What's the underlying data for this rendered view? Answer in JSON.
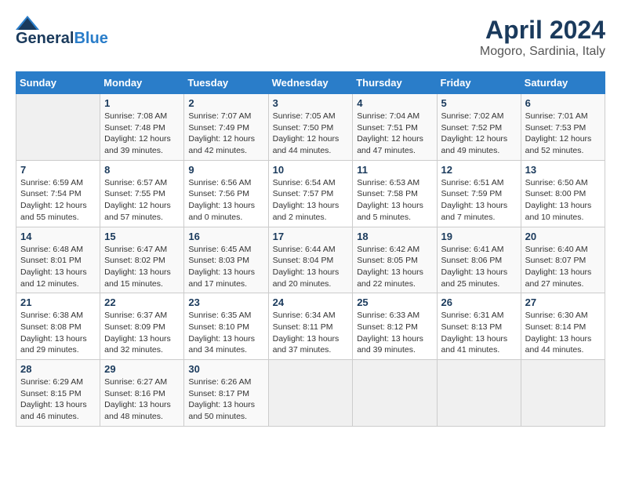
{
  "header": {
    "logo_line1": "General",
    "logo_line2": "Blue",
    "title": "April 2024",
    "subtitle": "Mogoro, Sardinia, Italy"
  },
  "columns": [
    "Sunday",
    "Monday",
    "Tuesday",
    "Wednesday",
    "Thursday",
    "Friday",
    "Saturday"
  ],
  "weeks": [
    [
      {
        "day": "",
        "info": ""
      },
      {
        "day": "1",
        "info": "Sunrise: 7:08 AM\nSunset: 7:48 PM\nDaylight: 12 hours\nand 39 minutes."
      },
      {
        "day": "2",
        "info": "Sunrise: 7:07 AM\nSunset: 7:49 PM\nDaylight: 12 hours\nand 42 minutes."
      },
      {
        "day": "3",
        "info": "Sunrise: 7:05 AM\nSunset: 7:50 PM\nDaylight: 12 hours\nand 44 minutes."
      },
      {
        "day": "4",
        "info": "Sunrise: 7:04 AM\nSunset: 7:51 PM\nDaylight: 12 hours\nand 47 minutes."
      },
      {
        "day": "5",
        "info": "Sunrise: 7:02 AM\nSunset: 7:52 PM\nDaylight: 12 hours\nand 49 minutes."
      },
      {
        "day": "6",
        "info": "Sunrise: 7:01 AM\nSunset: 7:53 PM\nDaylight: 12 hours\nand 52 minutes."
      }
    ],
    [
      {
        "day": "7",
        "info": "Sunrise: 6:59 AM\nSunset: 7:54 PM\nDaylight: 12 hours\nand 55 minutes."
      },
      {
        "day": "8",
        "info": "Sunrise: 6:57 AM\nSunset: 7:55 PM\nDaylight: 12 hours\nand 57 minutes."
      },
      {
        "day": "9",
        "info": "Sunrise: 6:56 AM\nSunset: 7:56 PM\nDaylight: 13 hours\nand 0 minutes."
      },
      {
        "day": "10",
        "info": "Sunrise: 6:54 AM\nSunset: 7:57 PM\nDaylight: 13 hours\nand 2 minutes."
      },
      {
        "day": "11",
        "info": "Sunrise: 6:53 AM\nSunset: 7:58 PM\nDaylight: 13 hours\nand 5 minutes."
      },
      {
        "day": "12",
        "info": "Sunrise: 6:51 AM\nSunset: 7:59 PM\nDaylight: 13 hours\nand 7 minutes."
      },
      {
        "day": "13",
        "info": "Sunrise: 6:50 AM\nSunset: 8:00 PM\nDaylight: 13 hours\nand 10 minutes."
      }
    ],
    [
      {
        "day": "14",
        "info": "Sunrise: 6:48 AM\nSunset: 8:01 PM\nDaylight: 13 hours\nand 12 minutes."
      },
      {
        "day": "15",
        "info": "Sunrise: 6:47 AM\nSunset: 8:02 PM\nDaylight: 13 hours\nand 15 minutes."
      },
      {
        "day": "16",
        "info": "Sunrise: 6:45 AM\nSunset: 8:03 PM\nDaylight: 13 hours\nand 17 minutes."
      },
      {
        "day": "17",
        "info": "Sunrise: 6:44 AM\nSunset: 8:04 PM\nDaylight: 13 hours\nand 20 minutes."
      },
      {
        "day": "18",
        "info": "Sunrise: 6:42 AM\nSunset: 8:05 PM\nDaylight: 13 hours\nand 22 minutes."
      },
      {
        "day": "19",
        "info": "Sunrise: 6:41 AM\nSunset: 8:06 PM\nDaylight: 13 hours\nand 25 minutes."
      },
      {
        "day": "20",
        "info": "Sunrise: 6:40 AM\nSunset: 8:07 PM\nDaylight: 13 hours\nand 27 minutes."
      }
    ],
    [
      {
        "day": "21",
        "info": "Sunrise: 6:38 AM\nSunset: 8:08 PM\nDaylight: 13 hours\nand 29 minutes."
      },
      {
        "day": "22",
        "info": "Sunrise: 6:37 AM\nSunset: 8:09 PM\nDaylight: 13 hours\nand 32 minutes."
      },
      {
        "day": "23",
        "info": "Sunrise: 6:35 AM\nSunset: 8:10 PM\nDaylight: 13 hours\nand 34 minutes."
      },
      {
        "day": "24",
        "info": "Sunrise: 6:34 AM\nSunset: 8:11 PM\nDaylight: 13 hours\nand 37 minutes."
      },
      {
        "day": "25",
        "info": "Sunrise: 6:33 AM\nSunset: 8:12 PM\nDaylight: 13 hours\nand 39 minutes."
      },
      {
        "day": "26",
        "info": "Sunrise: 6:31 AM\nSunset: 8:13 PM\nDaylight: 13 hours\nand 41 minutes."
      },
      {
        "day": "27",
        "info": "Sunrise: 6:30 AM\nSunset: 8:14 PM\nDaylight: 13 hours\nand 44 minutes."
      }
    ],
    [
      {
        "day": "28",
        "info": "Sunrise: 6:29 AM\nSunset: 8:15 PM\nDaylight: 13 hours\nand 46 minutes."
      },
      {
        "day": "29",
        "info": "Sunrise: 6:27 AM\nSunset: 8:16 PM\nDaylight: 13 hours\nand 48 minutes."
      },
      {
        "day": "30",
        "info": "Sunrise: 6:26 AM\nSunset: 8:17 PM\nDaylight: 13 hours\nand 50 minutes."
      },
      {
        "day": "",
        "info": ""
      },
      {
        "day": "",
        "info": ""
      },
      {
        "day": "",
        "info": ""
      },
      {
        "day": "",
        "info": ""
      }
    ]
  ]
}
